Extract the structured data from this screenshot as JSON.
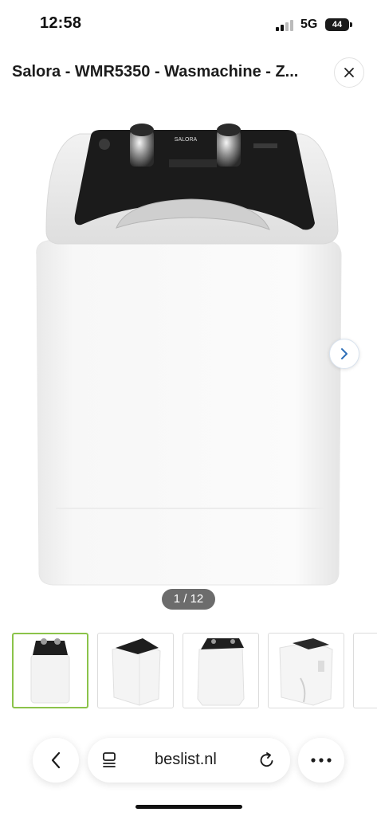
{
  "status_bar": {
    "time": "12:58",
    "network": "5G",
    "battery": "44"
  },
  "header": {
    "title": "Salora - WMR5350 - Wasmachine - Z...",
    "close_icon": "close-icon"
  },
  "gallery": {
    "brand_label": "SALORA",
    "pager": "1 / 12",
    "next_icon": "chevron-right-icon",
    "thumbnails": [
      "front",
      "side-left",
      "side-top",
      "back"
    ]
  },
  "bottom_bar": {
    "url": "beslist.nl",
    "back_icon": "chevron-left-icon",
    "tabs_icon": "page-icon",
    "reload_icon": "reload-icon",
    "more_icon": "more-icon"
  },
  "colors": {
    "selected_thumb": "#8bc34a",
    "pager_bg": "#6c6c6c",
    "next_ring": "#d9e3ef",
    "next_arrow": "#2f6fb8"
  }
}
